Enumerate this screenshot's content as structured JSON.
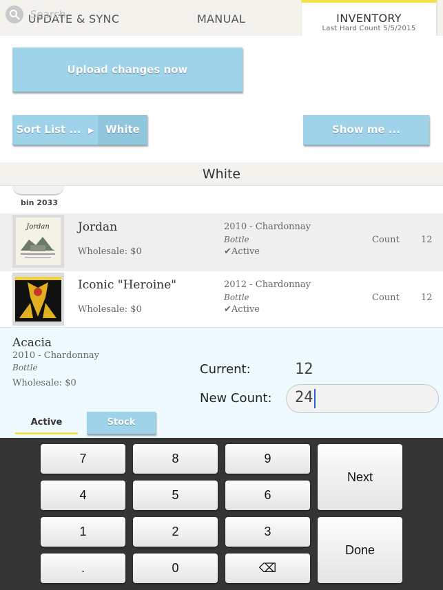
{
  "tabs": {
    "update_sync": "UPDATE & SYNC",
    "manual": "MANUAL",
    "inventory": "INVENTORY",
    "inventory_sub": "Last Hard Count 5/5/2015"
  },
  "toolbar": {
    "upload_label": "Upload changes now",
    "search_placeholder": "Search",
    "sort_label": "Sort List ...",
    "sort_value": "White",
    "show_me_label": "Show me ..."
  },
  "section_title": "White",
  "bin_label": "bin 2033",
  "wines": [
    {
      "name": "Jordan",
      "wholesale": "Wholesale:  $0",
      "vintage": "2010 - Chardonnay",
      "format": "Bottle",
      "status": "✔Active",
      "count_label": "Count",
      "count": "12"
    },
    {
      "name": "Iconic \"Heroine\"",
      "wholesale": "Wholesale:  $0",
      "vintage": "2012 - Chardonnay",
      "format": "Bottle",
      "status": "✔Active",
      "count_label": "Count",
      "count": "12"
    }
  ],
  "editor": {
    "name": "Acacia",
    "vintage": "2010 - Chardonnay",
    "format": "Bottle",
    "wholesale": "Wholesale:  $0",
    "current_label": "Current:",
    "current_value": "12",
    "new_count_label": "New Count:",
    "new_count_value": "24",
    "tab_active": "Active",
    "tab_stock": "Stock"
  },
  "keypad": {
    "k7": "7",
    "k8": "8",
    "k9": "9",
    "k4": "4",
    "k5": "5",
    "k6": "6",
    "k1": "1",
    "k2": "2",
    "k3": "3",
    "kdot": ".",
    "k0": "0",
    "kback": "⌫",
    "next": "Next",
    "done": "Done"
  },
  "colors": {
    "accent_yellow": "#f2e24c",
    "button_blue": "#9fd3ea",
    "editor_bg": "#eefafd",
    "keypad_bg": "#353535"
  }
}
